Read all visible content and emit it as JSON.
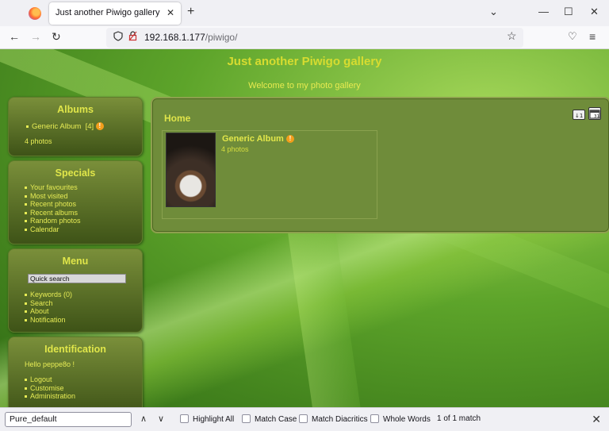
{
  "browser": {
    "tab_title": "Just another Piwigo gallery",
    "tab_close": "✕",
    "new_tab": "+",
    "chevron": "⌄",
    "minimize": "—",
    "maximize": "☐",
    "close": "✕",
    "url_host": "192.168.1.177",
    "url_path": "/piwigo/",
    "back": "←",
    "forward": "→",
    "reload": "↻",
    "bookmark_star": "☆",
    "pocket": "♡",
    "menu": "≡",
    "icons": [
      "firefox-logo",
      "shield-icon",
      "lock-icon",
      "star-icon",
      "pocket-icon",
      "hamburger-menu-icon"
    ]
  },
  "gallery": {
    "title": "Just another Piwigo gallery",
    "subtitle": "Welcome to my photo gallery"
  },
  "sidebar": {
    "albums": {
      "heading": "Albums",
      "item": "Generic Album",
      "item_count": "[4]",
      "badge": "!",
      "total": "4 photos"
    },
    "specials": {
      "heading": "Specials",
      "items": [
        "Your favourites",
        "Most visited",
        "Recent photos",
        "Recent albums",
        "Random photos",
        "Calendar"
      ]
    },
    "menu": {
      "heading": "Menu",
      "quick_search_placeholder": "Quick search",
      "items": [
        "Keywords (0)",
        "Search",
        "About",
        "Notification"
      ]
    },
    "identification": {
      "heading": "Identification",
      "greeting": "Hello peppe8o !",
      "items": [
        "Logout",
        "Customise",
        "Administration"
      ]
    }
  },
  "content": {
    "breadcrumb": "Home",
    "album": {
      "title": "Generic Album",
      "badge": "!",
      "photos": "4 photos"
    }
  },
  "findbar": {
    "query": "Pure_default",
    "up": "∧",
    "down": "∨",
    "highlight_all": "Highlight All",
    "match_case": "Match Case",
    "match_diacritics": "Match Diacritics",
    "whole_words": "Whole Words",
    "status": "1 of 1 match",
    "close": "✕"
  },
  "colors": {
    "accent_text": "#dfe44a",
    "panel": "#6f8c3a",
    "badge": "#f29e1b"
  }
}
